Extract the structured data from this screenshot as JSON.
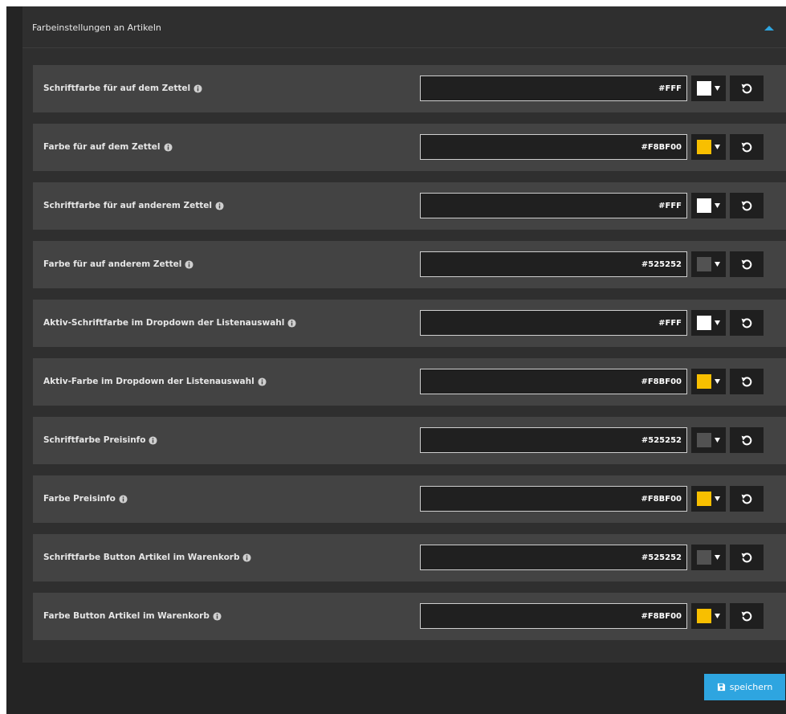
{
  "panel": {
    "title": "Farbeinstellungen an Artikeln",
    "collapse_icon": "caret-up-icon",
    "accent": "#2ea5e0"
  },
  "rows": [
    {
      "label": "Schriftfarbe für auf dem Zettel",
      "value": "#FFF",
      "swatch": "#FFFFFF"
    },
    {
      "label": "Farbe für auf dem Zettel",
      "value": "#F8BF00",
      "swatch": "#F8BF00"
    },
    {
      "label": "Schriftfarbe für auf anderem Zettel",
      "value": "#FFF",
      "swatch": "#FFFFFF"
    },
    {
      "label": "Farbe für auf anderem Zettel",
      "value": "#525252",
      "swatch": "#525252"
    },
    {
      "label": "Aktiv-Schriftfarbe im Dropdown der Listenauswahl",
      "value": "#FFF",
      "swatch": "#FFFFFF"
    },
    {
      "label": "Aktiv-Farbe im Dropdown der Listenauswahl",
      "value": "#F8BF00",
      "swatch": "#F8BF00"
    },
    {
      "label": "Schriftfarbe Preisinfo",
      "value": "#525252",
      "swatch": "#525252"
    },
    {
      "label": "Farbe Preisinfo",
      "value": "#F8BF00",
      "swatch": "#F8BF00"
    },
    {
      "label": "Schriftfarbe Button Artikel im Warenkorb",
      "value": "#525252",
      "swatch": "#525252"
    },
    {
      "label": "Farbe Button Artikel im Warenkorb",
      "value": "#F8BF00",
      "swatch": "#F8BF00"
    }
  ],
  "icons": {
    "info": "info-circle-icon",
    "caret": "caret-down-icon",
    "reset": "undo-icon",
    "save": "floppy-disk-icon"
  },
  "save_button": {
    "label": "speichern",
    "color": "#2ea5e0"
  }
}
